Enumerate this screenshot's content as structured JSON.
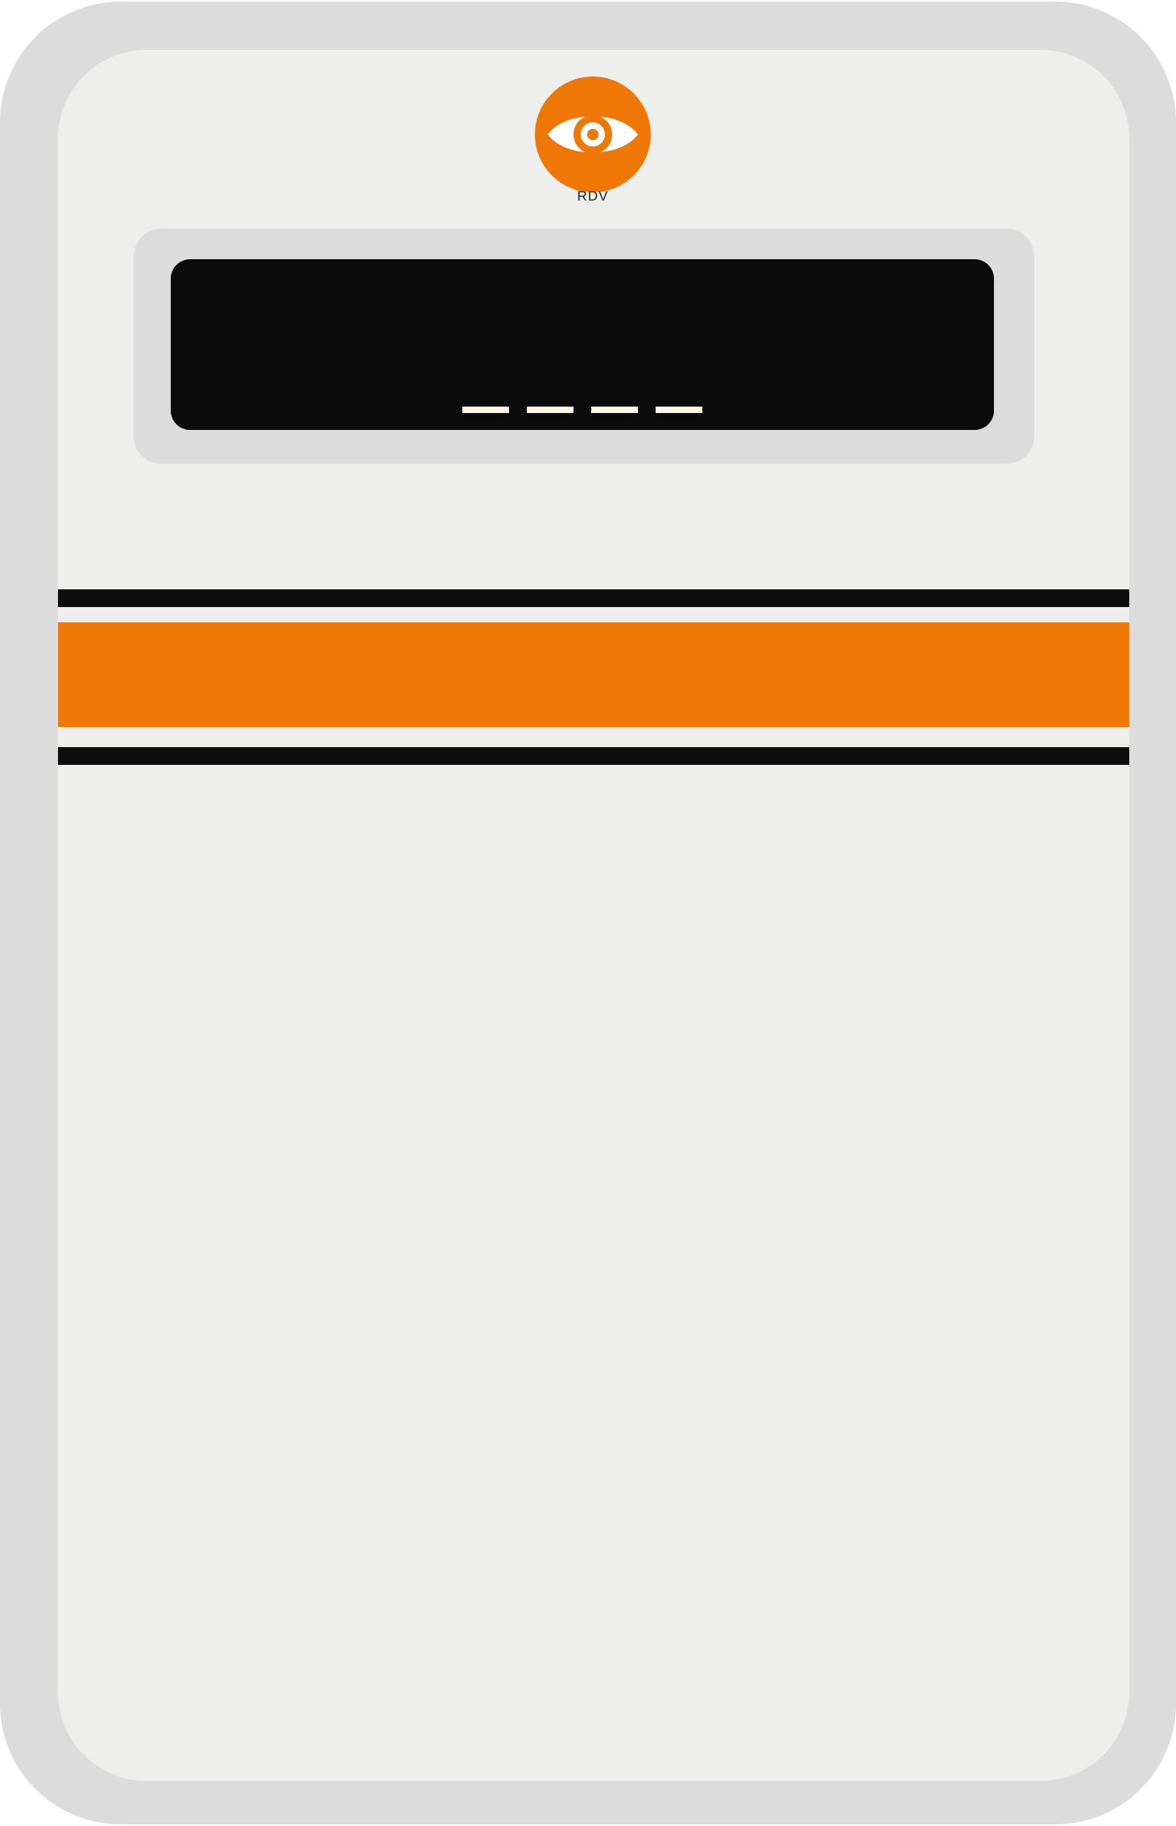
{
  "brand": {
    "name": "RDV",
    "logo_icon": "eye-icon",
    "accent_color": "#ee7705"
  },
  "display": {
    "pin_placeholder_count": 4,
    "pin_placeholder_glyph": "_"
  },
  "colors": {
    "device_body": "#dcdcdc",
    "device_face": "#eeeeed",
    "screen": "#0b0b0b",
    "stripe_dark": "#0e0e0e",
    "stripe_accent": "#ee7705",
    "pin_placeholder": "#fff6e6"
  }
}
